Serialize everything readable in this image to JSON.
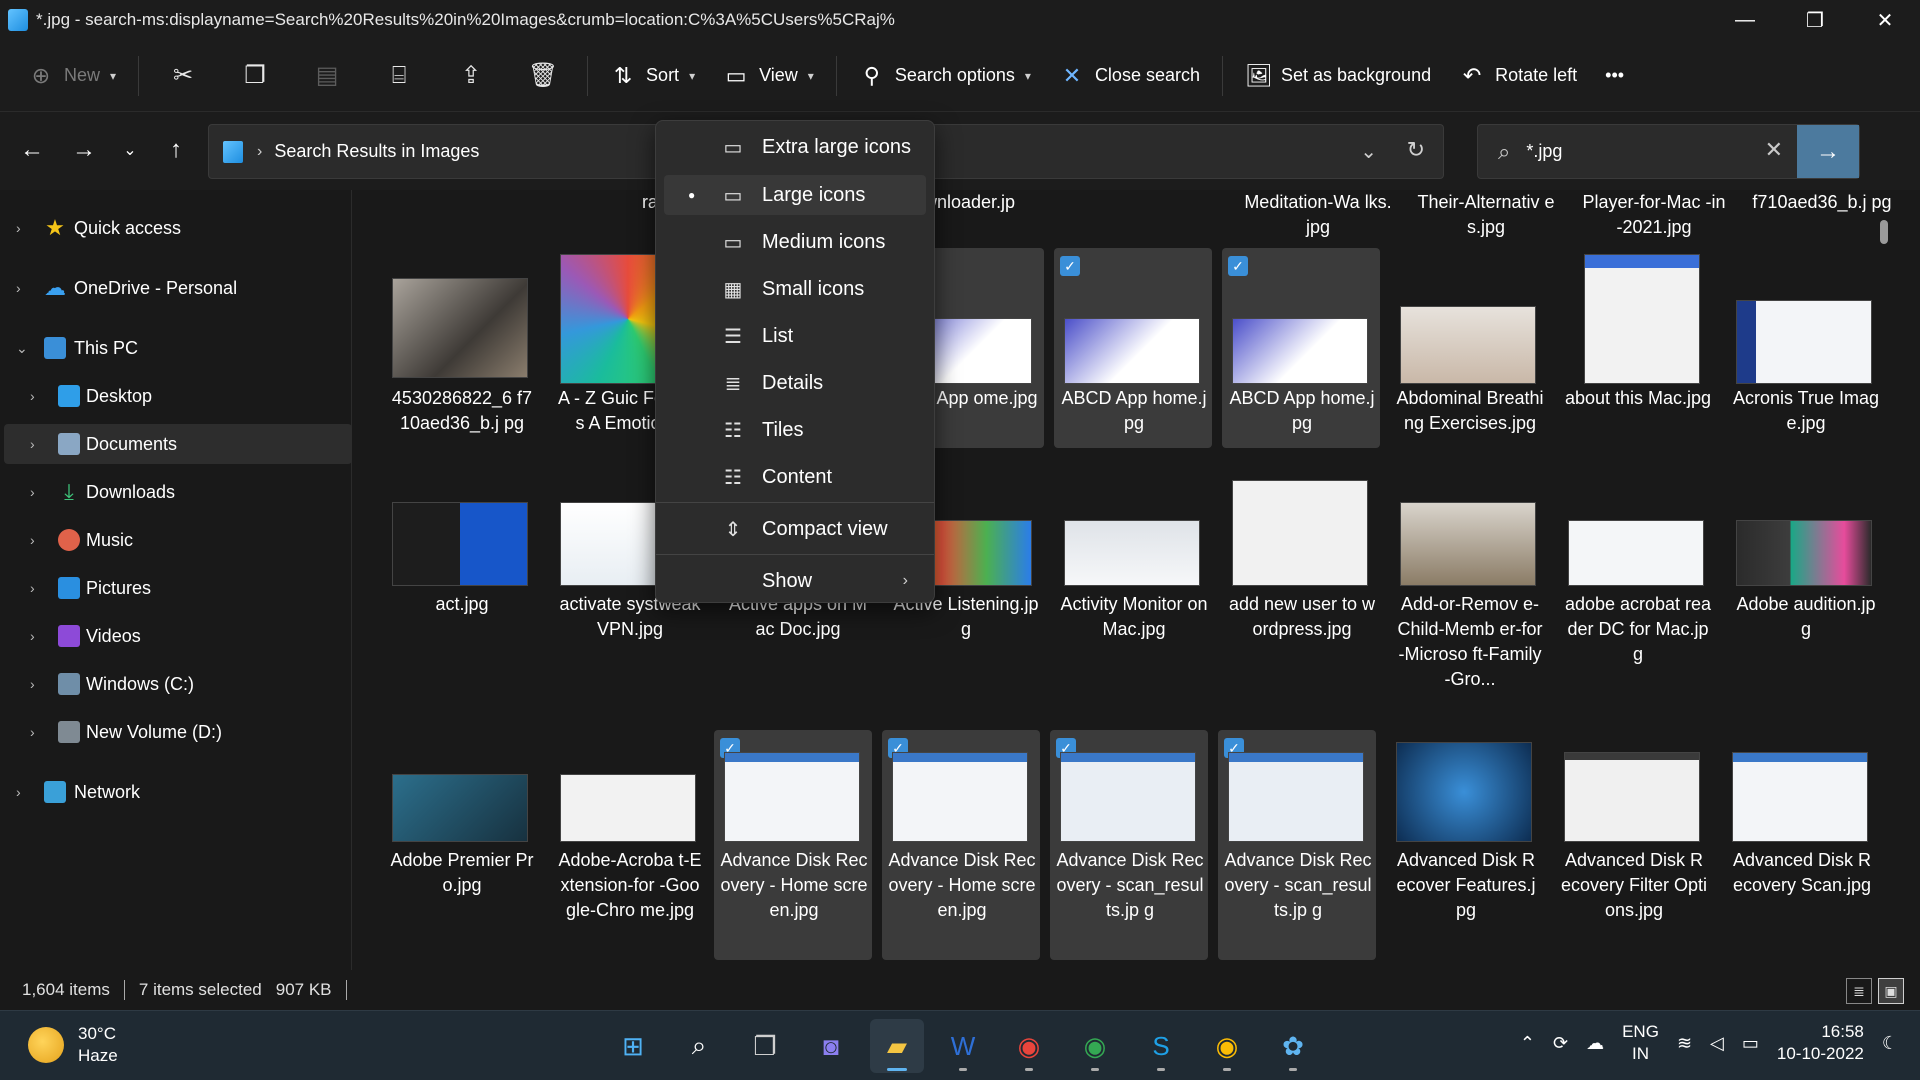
{
  "window": {
    "title": "*.jpg - search-ms:displayname=Search%20Results%20in%20Images&crumb=location:C%3A%5CUsers%5CRaj%",
    "minimize": "—",
    "maximize": "❐",
    "close": "✕"
  },
  "toolbar": {
    "new_label": "New",
    "sort_label": "Sort",
    "view_label": "View",
    "search_options_label": "Search options",
    "close_search_label": "Close search",
    "set_background_label": "Set as background",
    "rotate_left_label": "Rotate left",
    "more_label": "•••"
  },
  "address": {
    "breadcrumb": "Search Results in Images",
    "chevron": "›"
  },
  "search": {
    "value": "*.jpg"
  },
  "sidebar": {
    "items": [
      {
        "label": "Quick access"
      },
      {
        "label": "OneDrive - Personal"
      },
      {
        "label": "This PC"
      },
      {
        "label": "Desktop"
      },
      {
        "label": "Documents"
      },
      {
        "label": "Downloads"
      },
      {
        "label": "Music"
      },
      {
        "label": "Pictures"
      },
      {
        "label": "Videos"
      },
      {
        "label": "Windows (C:)"
      },
      {
        "label": "New Volume (D:)"
      },
      {
        "label": "Network"
      }
    ]
  },
  "view_menu": {
    "items": [
      {
        "label": "Extra large icons"
      },
      {
        "label": "Large icons"
      },
      {
        "label": "Medium icons"
      },
      {
        "label": "Small icons"
      },
      {
        "label": "List"
      },
      {
        "label": "Details"
      },
      {
        "label": "Tiles"
      },
      {
        "label": "Content"
      },
      {
        "label": "Compact view"
      },
      {
        "label": "Show"
      }
    ],
    "selected": "Large icons"
  },
  "files": {
    "top_row": [
      "rating.jpg",
      "wnloader.jp",
      "Meditation-Wa lks.jpg",
      "Their-Alternativ es.jpg",
      "Player-for-Mac -in-2021.jpg",
      "f710aed36_b.j pg"
    ],
    "row1": [
      "4530286822_6 f710aed36_b.j pg",
      "A - Z Guic Feelings A Emotions.",
      "BCD App ome.jpg",
      "ABCD App home.jpg",
      "ABCD App home.jpg",
      "Abdominal Breathing Exercises.jpg",
      "about this Mac.jpg",
      "Acronis True Image.jpg"
    ],
    "row2": [
      "act.jpg",
      "activate systweak VPN.jpg",
      "Active apps on Mac Doc.jpg",
      "Active Listening.jpg",
      "Activity Monitor on Mac.jpg",
      "add new user to wordpress.jpg",
      "Add-or-Remov e-Child-Memb er-for-Microso ft-Family-Gro...",
      "adobe acrobat reader DC for Mac.jpg",
      "Adobe audition.jpg"
    ],
    "row3": [
      "Adobe Premier Pro.jpg",
      "Adobe-Acroba t-Extension-for -Google-Chro me.jpg",
      "Advance Disk Recovery - Home screen.jpg",
      "Advance Disk Recovery - Home screen.jpg",
      "Advance Disk Recovery - scan_results.jp g",
      "Advance Disk Recovery - scan_results.jp g",
      "Advanced Disk Recover Features.jpg",
      "Advanced Disk Recovery Filter Options.jpg",
      "Advanced Disk Recovery Scan.jpg"
    ]
  },
  "status": {
    "items_count": "1,604 items",
    "selected": "7 items selected",
    "size": "907 KB"
  },
  "taskbar": {
    "temperature": "30°C",
    "condition": "Haze",
    "lang_top": "ENG",
    "lang_bottom": "IN",
    "time": "16:58",
    "date": "10-10-2022"
  },
  "colors": {
    "background": "#191919",
    "accent": "#3a8fd8",
    "selected_tile": "#3b3b3b",
    "menu_bg": "#2c2c2c"
  }
}
